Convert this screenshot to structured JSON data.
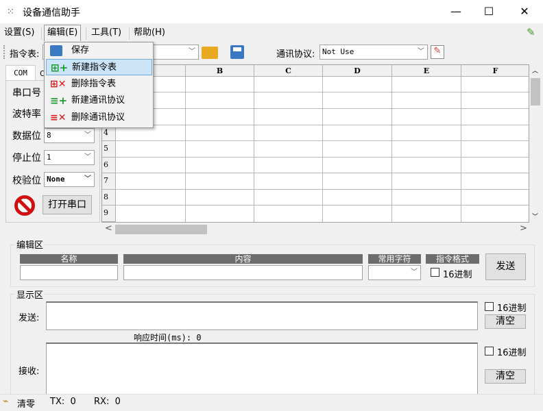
{
  "window": {
    "title": "设备通信助手",
    "minimize": "—",
    "maximize": "☐",
    "close": "✕"
  },
  "menubar": [
    {
      "label": "设置(S)"
    },
    {
      "label": "编辑(E)"
    },
    {
      "label": "工具(T)"
    },
    {
      "label": "帮助(H)"
    }
  ],
  "edit_menu": {
    "items": [
      {
        "label": "保存",
        "icon": "save-icon"
      },
      {
        "label": "新建指令表",
        "icon": "new-table-icon",
        "highlighted": true
      },
      {
        "label": "删除指令表",
        "icon": "delete-table-icon"
      },
      {
        "label": "新建通讯协议",
        "icon": "new-protocol-icon"
      },
      {
        "label": "删除通讯协议",
        "icon": "delete-protocol-icon"
      }
    ]
  },
  "toolbar": {
    "command_table_label": "指令表:",
    "command_table_value": "",
    "protocol_label": "通讯协议:",
    "protocol_value": "Not Use"
  },
  "tabs": [
    {
      "label": "COM",
      "active": true
    },
    {
      "label": "C"
    }
  ],
  "serial": {
    "port_label": "串口号",
    "baud_label": "波特率",
    "databits_label": "数据位",
    "databits_value": "8",
    "stopbits_label": "停止位",
    "stopbits_value": "1",
    "parity_label": "校验位",
    "parity_value": "None",
    "open_button": "打开串口"
  },
  "grid": {
    "columns": [
      "",
      "B",
      "C",
      "D",
      "E",
      "F"
    ],
    "rows": [
      "",
      "",
      "",
      "4",
      "5",
      "6",
      "7",
      "8",
      "9"
    ],
    "scroll_left": "<",
    "scroll_right": ">"
  },
  "edit_area": {
    "title": "编辑区",
    "name_header": "名称",
    "content_header": "内容",
    "common_chars_header": "常用字符",
    "format_header": "指令格式",
    "hex_label": "16进制",
    "send_button": "发送"
  },
  "display_area": {
    "title": "显示区",
    "send_label": "发送:",
    "send_hex_label": "16进制",
    "send_clear": "清空",
    "response_time": "响应时间(ms): 0",
    "recv_label": "接收:",
    "recv_hex_label": "16进制",
    "recv_clear": "清空"
  },
  "status": {
    "clear": "清零",
    "tx": "TX:  0",
    "rx": "RX:  0"
  },
  "colors": {
    "accent_highlight": "#cce4f7",
    "header_bar": "#6d6d6d",
    "stop_red": "#d01010"
  }
}
